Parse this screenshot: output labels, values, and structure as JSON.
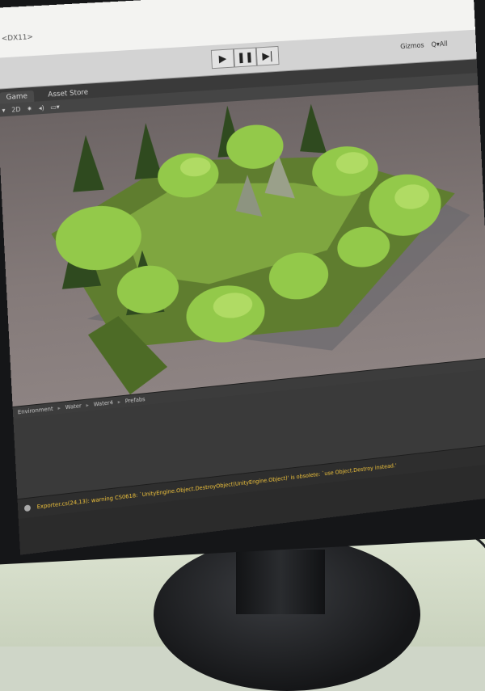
{
  "editor": {
    "window_title": "<DX11>",
    "toolbar": {
      "play_icon": "play-icon",
      "pause_icon": "pause-icon",
      "step_icon": "step-icon",
      "gizmos_label": "Gizmos",
      "search_label": "Q▾All"
    },
    "tabs": [
      {
        "label": "Game"
      },
      {
        "label": "Asset Store"
      }
    ],
    "scene_toolbar": {
      "mode_2d": "2D"
    },
    "breadcrumb": [
      "Environment",
      "Water",
      "Water4",
      "Prefabs"
    ],
    "console_message": "Exporter.cs(24,13): warning CS0618: `UnityEngine.Object.DestroyObject(UnityEngine.Object)' is obsolete: `use Object.Destroy instead.'"
  },
  "colors": {
    "sky": "#847a79",
    "terrain": "#6f8f3a",
    "foliage": "#93c94a",
    "warning_text": "#f0c33c"
  }
}
